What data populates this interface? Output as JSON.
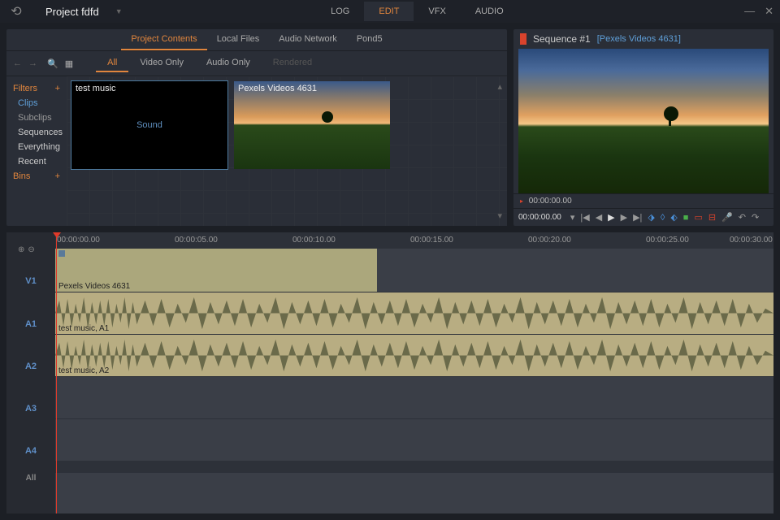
{
  "titlebar": {
    "project_label": "Project fdfd"
  },
  "main_tabs": {
    "log": "LOG",
    "edit": "EDIT",
    "vfx": "VFX",
    "audio": "AUDIO"
  },
  "project_tabs": {
    "contents": "Project Contents",
    "local": "Local Files",
    "network": "Audio Network",
    "pond5": "Pond5"
  },
  "filter_tabs": {
    "all": "All",
    "video_only": "Video Only",
    "audio_only": "Audio Only",
    "rendered": "Rendered"
  },
  "sidebar": {
    "filters_label": "Filters",
    "clips": "Clips",
    "subclips": "Subclips",
    "sequences": "Sequences",
    "everything": "Everything",
    "recent": "Recent",
    "bins_label": "Bins"
  },
  "clips": [
    {
      "name": "test music",
      "center_text": "Sound"
    },
    {
      "name": "Pexels Videos 4631"
    }
  ],
  "sequence": {
    "title": "Sequence #1",
    "subtitle": "[Pexels Videos 4631]",
    "tc_small": "00:00:00.00",
    "tc_main": "00:00:00.00"
  },
  "ruler": [
    "00:00:00.00",
    "00:00:05.00",
    "00:00:10.00",
    "00:00:15.00",
    "00:00:20.00",
    "00:00:25.00",
    "00:00:30.00"
  ],
  "tracks": {
    "v1": "V1",
    "a1": "A1",
    "a2": "A2",
    "a3": "A3",
    "a4": "A4",
    "all": "All"
  },
  "timeline_clips": {
    "video_label": "Pexels Videos 4631",
    "audio1_label": "test music, A1",
    "audio2_label": "test music, A2"
  }
}
